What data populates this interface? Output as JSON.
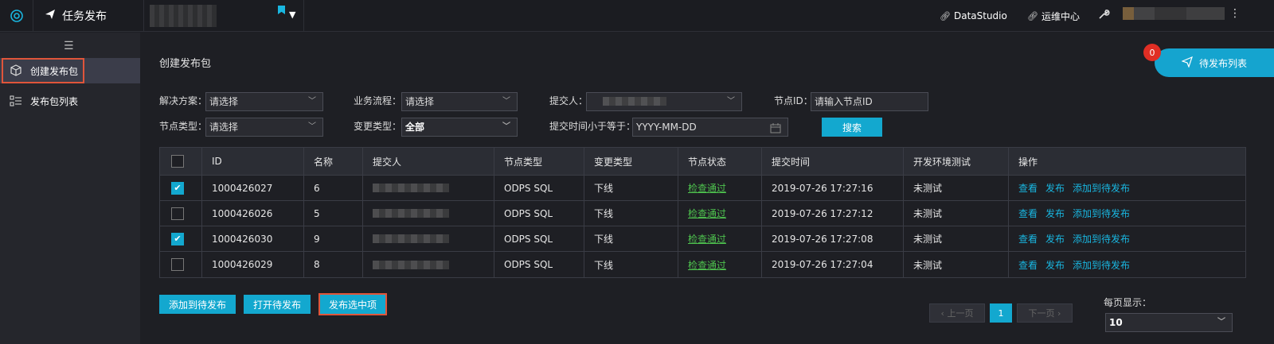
{
  "header": {
    "app_title": "任务发布",
    "links": [
      "DataStudio",
      "运维中心"
    ]
  },
  "sidebar": {
    "items": [
      {
        "label": "创建发布包",
        "active": true
      },
      {
        "label": "发布包列表",
        "active": false
      }
    ]
  },
  "main": {
    "title": "创建发布包",
    "pending_button": "待发布列表",
    "pending_count": "0"
  },
  "filters": {
    "solution_label": "解决方案：",
    "solution_value": "请选择",
    "flow_label": "业务流程：",
    "flow_value": "请选择",
    "submitter_label": "提交人：",
    "node_id_label": "节点ID：",
    "node_id_placeholder": "请输入节点ID",
    "node_type_label": "节点类型：",
    "node_type_value": "请选择",
    "change_type_label": "变更类型：",
    "change_type_value": "全部",
    "submit_time_label": "提交时间小于等于：",
    "submit_time_placeholder": "YYYY-MM-DD",
    "search_button": "搜索"
  },
  "table": {
    "headers": [
      "ID",
      "名称",
      "提交人",
      "节点类型",
      "变更类型",
      "节点状态",
      "提交时间",
      "开发环境测试",
      "操作"
    ],
    "rows": [
      {
        "checked": true,
        "id": "1000426027",
        "name": "6",
        "node_type": "ODPS SQL",
        "change_type": "下线",
        "status": "检查通过",
        "time": "2019-07-26 17:27:16",
        "dev_test": "未测试"
      },
      {
        "checked": false,
        "id": "1000426026",
        "name": "5",
        "node_type": "ODPS SQL",
        "change_type": "下线",
        "status": "检查通过",
        "time": "2019-07-26 17:27:12",
        "dev_test": "未测试"
      },
      {
        "checked": true,
        "id": "1000426030",
        "name": "9",
        "node_type": "ODPS SQL",
        "change_type": "下线",
        "status": "检查通过",
        "time": "2019-07-26 17:27:08",
        "dev_test": "未测试"
      },
      {
        "checked": false,
        "id": "1000426029",
        "name": "8",
        "node_type": "ODPS SQL",
        "change_type": "下线",
        "status": "检查通过",
        "time": "2019-07-26 17:27:04",
        "dev_test": "未测试"
      }
    ],
    "actions": [
      "查看",
      "发布",
      "添加到待发布"
    ]
  },
  "footer": {
    "add_pending": "添加到待发布",
    "open_pending": "打开待发布",
    "publish_selected": "发布选中项",
    "prev_page": "上一页",
    "current_page": "1",
    "next_page": "下一页",
    "per_page_label": "每页显示：",
    "per_page_value": "10"
  },
  "colors": {
    "accent": "#13a8cf",
    "highlight": "#e0553a",
    "status_ok": "#4ec24e",
    "badge": "#e02e24"
  }
}
